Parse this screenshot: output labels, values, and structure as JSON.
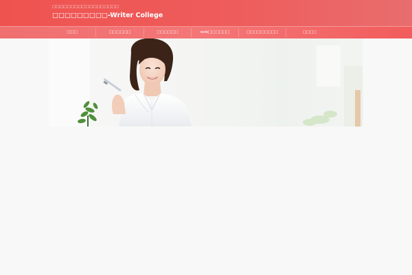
{
  "header": {
    "tagline": "□□□□□□□□□□□□□□□□□□",
    "title": "□□□□□□□□□-Writer College"
  },
  "nav": {
    "items": [
      {
        "label": "□□□"
      },
      {
        "label": "□□□□□□"
      },
      {
        "label": "□□□□□□"
      },
      {
        "label": "web□□□□□□"
      },
      {
        "label": "□□□□□□□□□"
      },
      {
        "label": "□□□□"
      }
    ]
  },
  "hero": {
    "icon": "woman-holding-pen-photo",
    "colors": {
      "page_bg": "#f8f8f8",
      "header_red": "#ef5350",
      "nav_red": "#f47677"
    }
  }
}
